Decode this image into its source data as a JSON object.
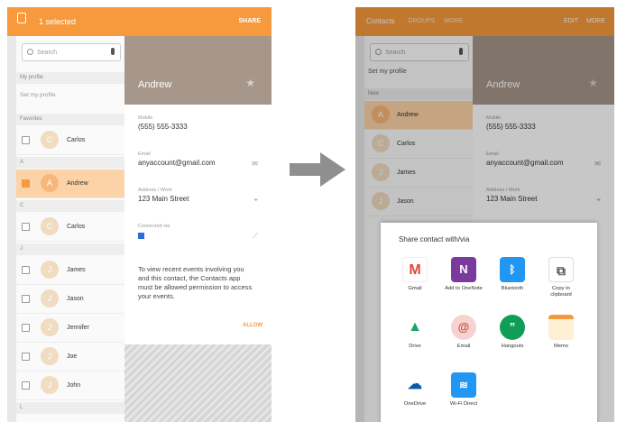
{
  "left": {
    "topbar": {
      "title": "1 selected",
      "share": "SHARE"
    },
    "search_placeholder": "Search",
    "sections": {
      "my_profile": "My profile",
      "set_profile": "Set my profile",
      "favorites": "Favorites",
      "a": "A",
      "c": "C",
      "j": "J",
      "l": "L"
    },
    "contacts": [
      "Carlos",
      "Andrew",
      "Carlos",
      "James",
      "Jason",
      "Jennifer",
      "Joe",
      "John"
    ],
    "detail": {
      "name": "Andrew",
      "mobile_label": "Mobile",
      "mobile": "(555) 555-3333",
      "email_label": "Email",
      "email": "anyaccount@gmail.com",
      "address_label": "Address / Work",
      "address": "123 Main Street",
      "connected_label": "Connected via",
      "message": "To view recent events involving you and this contact, the Contacts app must be allowed permission to access your events.",
      "allow": "ALLOW"
    }
  },
  "right": {
    "topbar": {
      "contacts": "Contacts",
      "groups": "GROUPS",
      "more": "MORE",
      "edit": "EDIT",
      "more2": "MORE"
    },
    "search_placeholder": "Search",
    "sections": {
      "set_profile": "Set my profile",
      "new": "New"
    },
    "contacts": [
      "Andrew",
      "Carlos",
      "James",
      "Jason"
    ],
    "detail": {
      "name": "Andrew",
      "mobile_label": "Mobile",
      "mobile": "(555) 555-3333",
      "email_label": "Email",
      "email": "anyaccount@gmail.com",
      "address_label": "Address / Work",
      "address": "123 Main Street"
    },
    "sheet": {
      "title": "Share contact with/via",
      "apps": [
        "Gmail",
        "Add to OneNote",
        "Bluetooth",
        "Copy to clipboard",
        "Drive",
        "Email",
        "Hangouts",
        "Memo",
        "OneDrive",
        "Wi-Fi Direct"
      ]
    }
  },
  "colors": {
    "accent": "#f79a3d",
    "hero": "#a6978a",
    "selected_row": "#fbd3a6"
  }
}
